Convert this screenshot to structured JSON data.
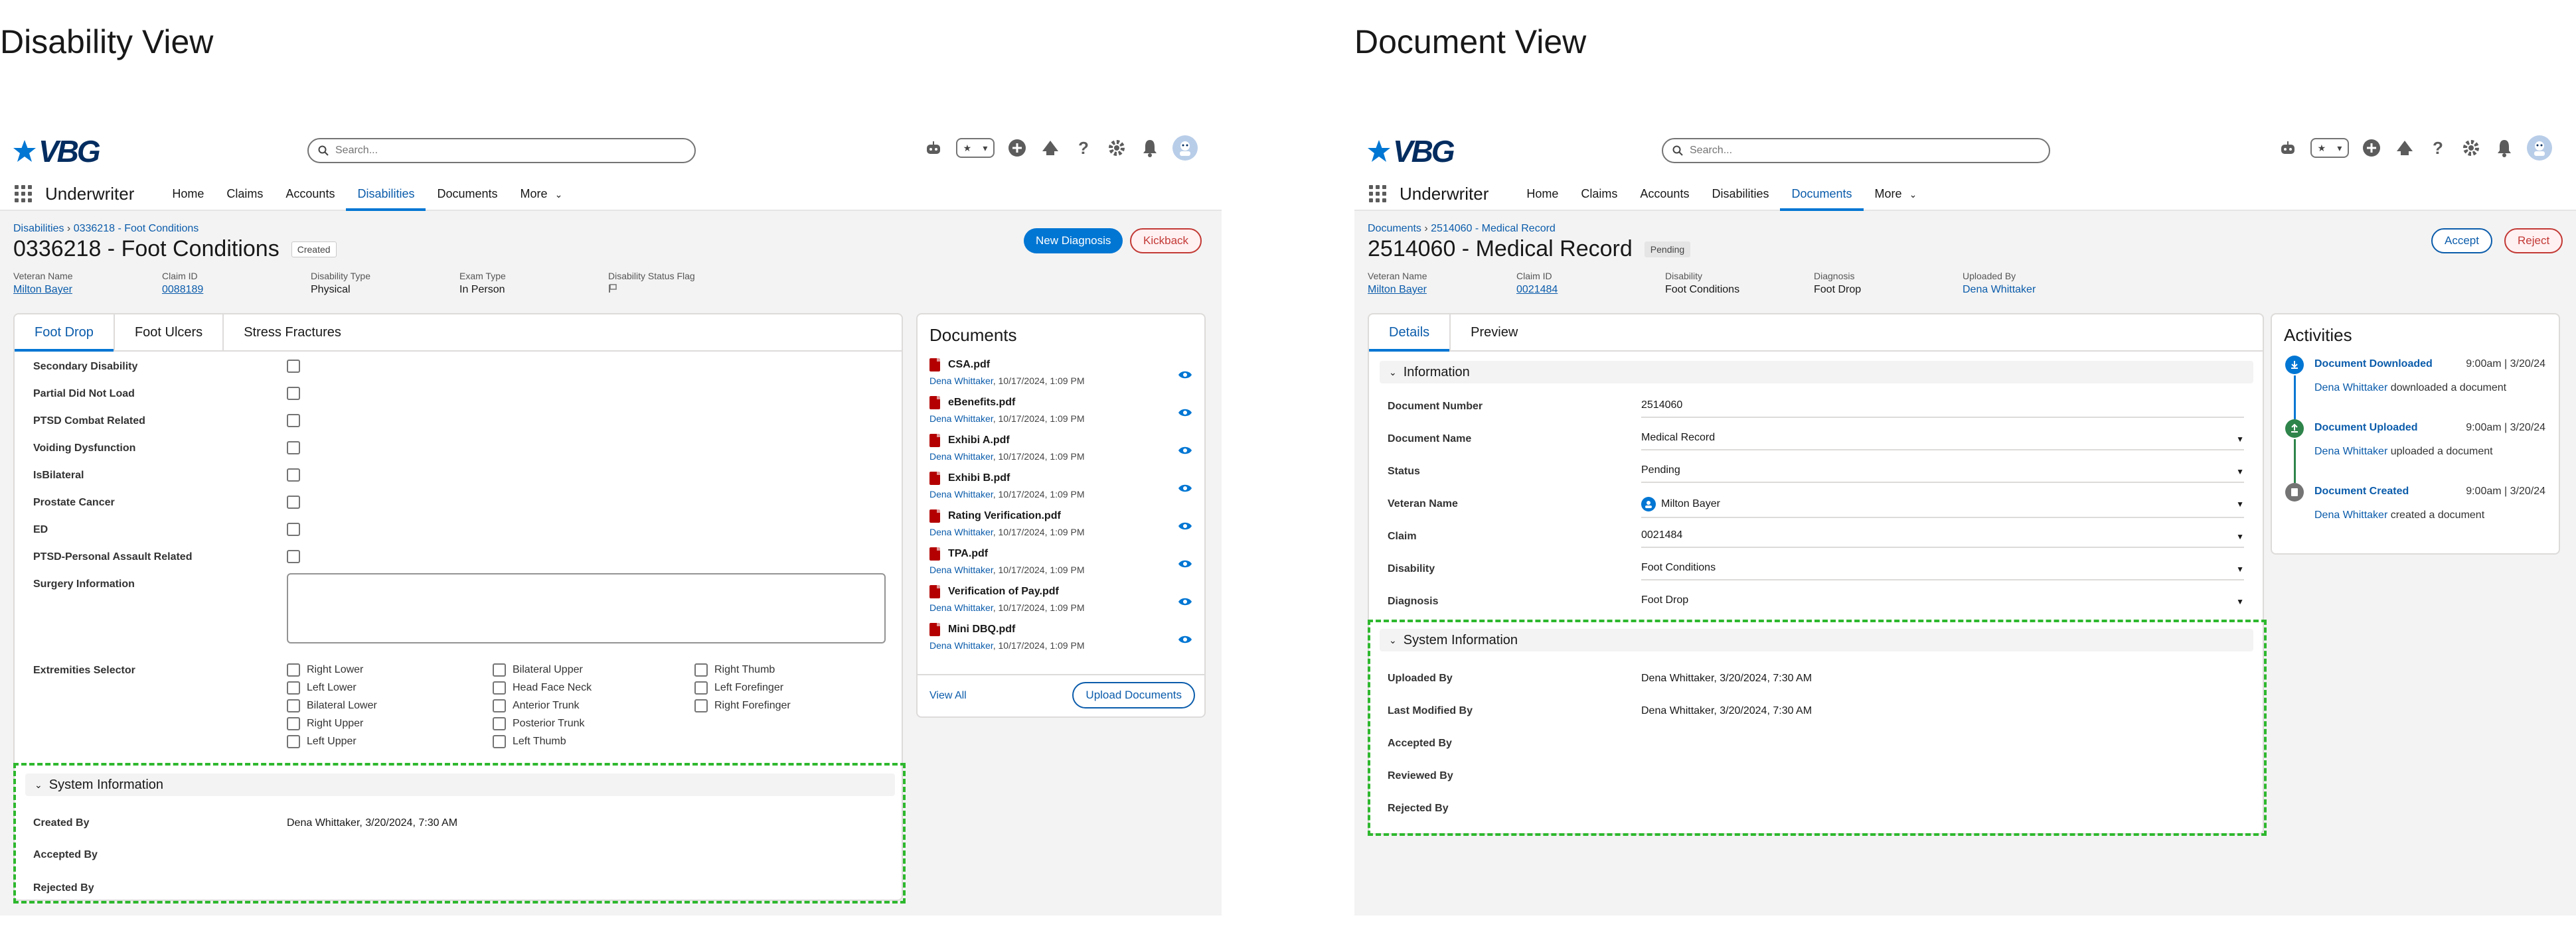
{
  "left_title": "Disability View",
  "right_title": "Document View",
  "app": {
    "logo_text": "VBG",
    "name": "Underwriter",
    "search_placeholder": "Search...",
    "nav": [
      "Home",
      "Claims",
      "Accounts",
      "Disabilities",
      "Documents",
      "More"
    ]
  },
  "disability": {
    "breadcrumb_root": "Disabilities",
    "breadcrumb_current": "0336218 - Foot Conditions",
    "title": "0336218 - Foot Conditions",
    "status": "Created",
    "btn_new": "New Diagnosis",
    "btn_kick": "Kickback",
    "fields": [
      {
        "label": "Veteran Name",
        "value": "Milton Bayer"
      },
      {
        "label": "Claim ID",
        "value": "0088189"
      },
      {
        "label": "Disability Type",
        "value": "Physical"
      },
      {
        "label": "Exam Type",
        "value": "In Person"
      },
      {
        "label": "Disability Status Flag",
        "value": ""
      }
    ],
    "tabs": [
      "Foot Drop",
      "Foot Ulcers",
      "Stress Fractures"
    ],
    "checkbox_rows": [
      "Secondary Disability",
      "Partial Did Not Load",
      "PTSD Combat Related",
      "Voiding Dysfunction",
      "IsBilateral",
      "Prostate Cancer",
      "ED",
      "PTSD-Personal Assault Related"
    ],
    "surgery_label": "Surgery Information",
    "extremities_label": "Extremities Selector",
    "extremities": [
      [
        "Right Lower",
        "Left Lower",
        "Bilateral Lower",
        "Right Upper",
        "Left Upper"
      ],
      [
        "Bilateral Upper",
        "Head Face Neck",
        "Anterior Trunk",
        "Posterior Trunk",
        "Left Thumb"
      ],
      [
        "Right Thumb",
        "Left Forefinger",
        "Right Forefinger"
      ]
    ],
    "system_info": {
      "header": "System Information",
      "rows": [
        {
          "label": "Created By",
          "value": "Dena Whittaker, 3/20/2024, 7:30 AM"
        },
        {
          "label": "Accepted By",
          "value": ""
        },
        {
          "label": "Rejected By",
          "value": ""
        }
      ]
    },
    "documents": {
      "title": "Documents",
      "items": [
        {
          "name": "CSA.pdf",
          "user": "Dena Whittaker",
          "date": ", 10/17/2024, 1:09 PM"
        },
        {
          "name": "eBenefits.pdf",
          "user": "Dena Whittaker",
          "date": ", 10/17/2024, 1:09 PM"
        },
        {
          "name": "Exhibi A.pdf",
          "user": "Dena Whittaker",
          "date": ", 10/17/2024, 1:09 PM"
        },
        {
          "name": "Exhibi B.pdf",
          "user": "Dena Whittaker",
          "date": ", 10/17/2024, 1:09 PM"
        },
        {
          "name": "Rating Verification.pdf",
          "user": "Dena Whittaker",
          "date": ", 10/17/2024, 1:09 PM"
        },
        {
          "name": "TPA.pdf",
          "user": "Dena Whittaker",
          "date": ", 10/17/2024, 1:09 PM"
        },
        {
          "name": "Verification of Pay.pdf",
          "user": "Dena Whittaker",
          "date": ", 10/17/2024, 1:09 PM"
        },
        {
          "name": "Mini DBQ.pdf",
          "user": "Dena Whittaker",
          "date": ", 10/17/2024, 1:09 PM"
        }
      ],
      "view_all": "View All",
      "upload": "Upload Documents"
    }
  },
  "document": {
    "breadcrumb_root": "Documents",
    "breadcrumb_current": "2514060 - Medical Record",
    "title": "2514060 - Medical Record",
    "status": "Pending",
    "btn_accept": "Accept",
    "btn_reject": "Reject",
    "fields": [
      {
        "label": "Veteran Name",
        "value": "Milton Bayer",
        "link": true
      },
      {
        "label": "Claim ID",
        "value": "0021484",
        "link": true
      },
      {
        "label": "Disability",
        "value": "Foot Conditions",
        "link": false
      },
      {
        "label": "Diagnosis",
        "value": "Foot Drop",
        "link": false
      },
      {
        "label": "Uploaded By",
        "value": "Dena Whittaker",
        "link": true
      }
    ],
    "tabs": [
      "Details",
      "Preview"
    ],
    "info_header": "Information",
    "info_rows": [
      {
        "label": "Document Number",
        "value": "2514060"
      },
      {
        "label": "Document Name",
        "value": "Medical Record"
      },
      {
        "label": "Status",
        "value": "Pending"
      },
      {
        "label": "Veteran Name",
        "value": "Milton Bayer"
      },
      {
        "label": "Claim",
        "value": "0021484"
      },
      {
        "label": "Disability",
        "value": "Foot Conditions"
      },
      {
        "label": "Diagnosis",
        "value": "Foot Drop"
      }
    ],
    "system_info": {
      "header": "System Information",
      "rows": [
        {
          "label": "Uploaded By",
          "value": "Dena Whittaker, 3/20/2024, 7:30 AM"
        },
        {
          "label": "Last Modified By",
          "value": "Dena Whittaker, 3/20/2024, 7:30 AM"
        },
        {
          "label": "Accepted By",
          "value": ""
        },
        {
          "label": "Reviewed By",
          "value": ""
        },
        {
          "label": "Rejected By",
          "value": ""
        }
      ]
    },
    "activities": {
      "title": "Activities",
      "items": [
        {
          "title": "Document Downloaded",
          "when": "9:00am | 3/20/24",
          "user": "Dena Whittaker",
          "action": " downloaded a document",
          "color": "#0176d3"
        },
        {
          "title": "Document Uploaded",
          "when": "9:00am | 3/20/24",
          "user": "Dena Whittaker",
          "action": " uploaded a document",
          "color": "#2e844a"
        },
        {
          "title": "Document Created",
          "when": "9:00am | 3/20/24",
          "user": "Dena Whittaker",
          "action": " created a document",
          "color": "#747474"
        }
      ]
    }
  },
  "colors": {
    "brand": "#0176d3",
    "system_box": "#2eb82e",
    "danger": "#c23934"
  }
}
